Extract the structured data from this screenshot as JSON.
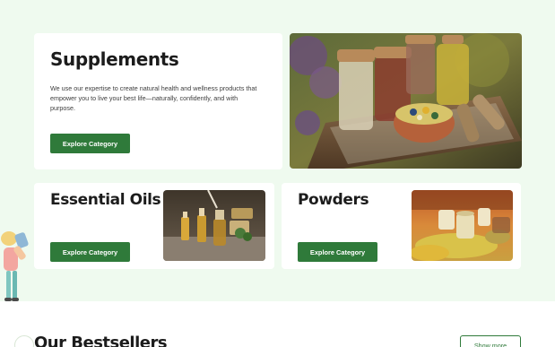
{
  "categories": {
    "supplements": {
      "title": "Supplements",
      "description": "We use our expertise to create natural health and wellness products that empower you to live your best life—naturally, confidently, and with purpose.",
      "button_label": "Explore Category"
    },
    "essential_oils": {
      "title": "Essential Oils",
      "button_label": "Explore Category"
    },
    "powders": {
      "title": "Powders",
      "button_label": "Explore Category"
    }
  },
  "bestsellers": {
    "title": "Our Bestsellers",
    "show_more_label": "Show more"
  },
  "colors": {
    "hero_background": "#effaef",
    "accent_green": "#2f7a3a",
    "heading_text": "#1c1c1c"
  },
  "icons": [
    "herb-jars-photo",
    "essential-oil-bottles-photo",
    "powder-bowls-photo",
    "water-drinker-illustration",
    "leaf-ring-icon"
  ]
}
